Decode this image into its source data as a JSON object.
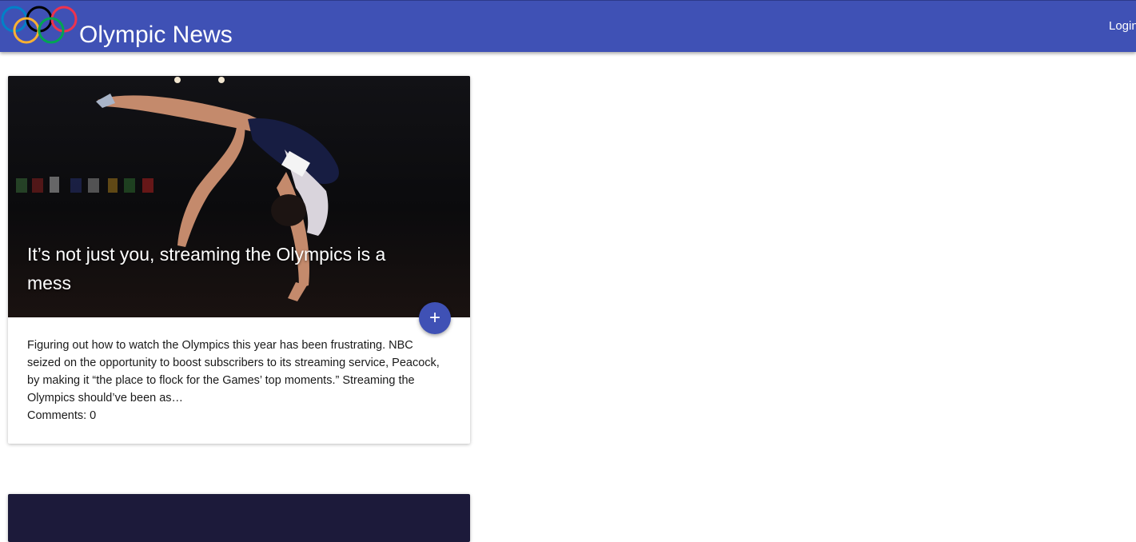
{
  "header": {
    "site_title": "Olympic News",
    "login_label": "Login",
    "logo_icon": "olympic-rings-icon",
    "colors": {
      "primary": "#3f51b5",
      "ring_blue": "#0081c8",
      "ring_yellow": "#fcb131",
      "ring_black": "#000000",
      "ring_green": "#00a651",
      "ring_red": "#ee334e"
    }
  },
  "articles": [
    {
      "title": "It’s not just you, streaming the Olympics is a mess",
      "excerpt": "Figuring out how to watch the Olympics this year has been frustrating. NBC seized on the opportunity to boost subscribers to its streaming service, Peacock, by making it “the place to flock for the Games’ top moments.” Streaming the Olympics should’ve been as…",
      "comments_label": "Comments: 0",
      "action_icon": "plus-icon",
      "action_symbol": "+"
    }
  ]
}
